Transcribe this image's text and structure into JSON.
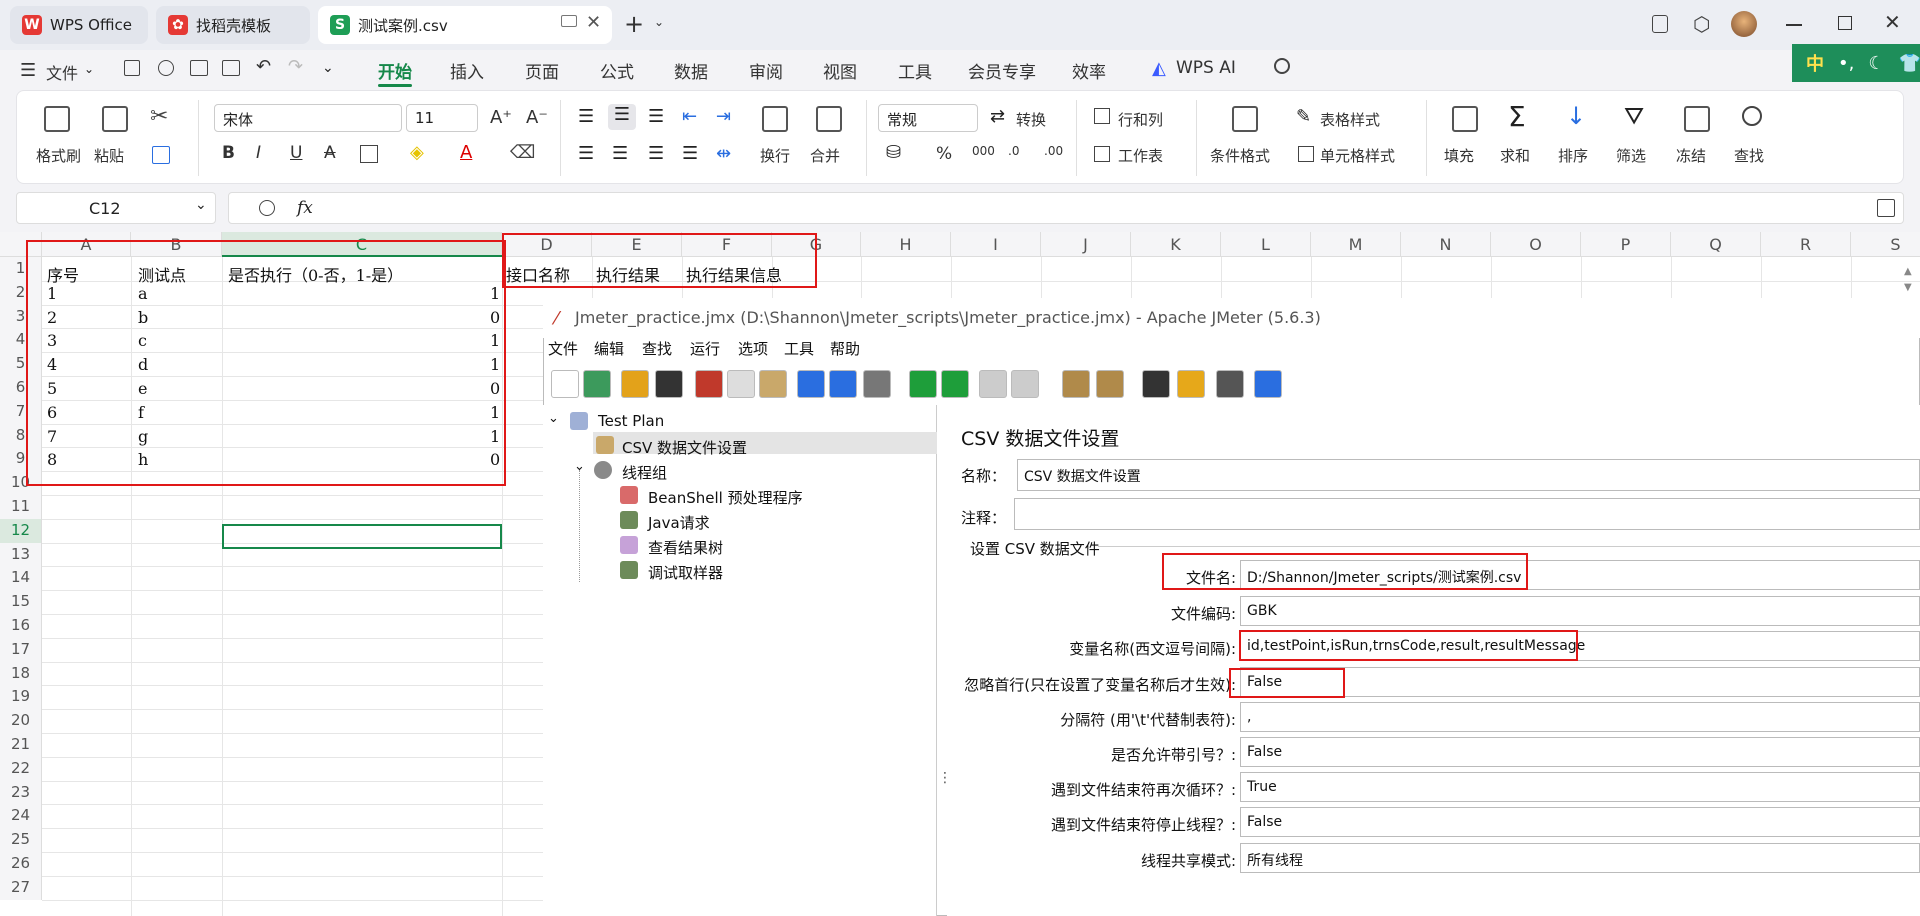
{
  "tabs": [
    {
      "label": "WPS Office"
    },
    {
      "label": "找稻壳模板"
    },
    {
      "label": "测试案例.csv"
    }
  ],
  "menu": {
    "file": "文件",
    "items": [
      "开始",
      "插入",
      "页面",
      "公式",
      "数据",
      "审阅",
      "视图",
      "工具",
      "会员专享",
      "效率"
    ],
    "wps_ai": "WPS AI",
    "ime": "中"
  },
  "ribbon": {
    "format_painter": "格式刷",
    "paste": "粘贴",
    "font": "宋体",
    "font_size": "11",
    "bold": "B",
    "italic": "I",
    "underline": "U",
    "wrap": "换行",
    "merge": "合并",
    "number_format": "常规",
    "convert": "转换",
    "rowcol": "行和列",
    "worksheet": "工作表",
    "cond_format": "条件格式",
    "table_style": "表格样式",
    "cell_style": "单元格样式",
    "fill": "填充",
    "sum": "求和",
    "sort": "排序",
    "filter": "筛选",
    "freeze": "冻结",
    "find": "查找"
  },
  "formula": {
    "cell_ref": "C12",
    "fx": "fx"
  },
  "sheet": {
    "columns": [
      "A",
      "B",
      "C",
      "D",
      "E",
      "F",
      "G",
      "H",
      "I",
      "J",
      "K",
      "L",
      "M",
      "N",
      "O",
      "P",
      "Q",
      "R",
      "S"
    ],
    "rows": [
      "1",
      "2",
      "3",
      "4",
      "5",
      "6",
      "7",
      "8",
      "9",
      "10",
      "11",
      "12",
      "13",
      "14",
      "15",
      "16",
      "17",
      "18",
      "19",
      "20",
      "21",
      "22",
      "23",
      "24",
      "25",
      "26",
      "27"
    ],
    "header": {
      "a": "序号",
      "b": "测试点",
      "c": "是否执行（0-否，1-是）",
      "d": "接口名称",
      "e": "执行结果",
      "f": "执行结果信息"
    },
    "data": [
      {
        "a": "1",
        "b": "a",
        "c": "1"
      },
      {
        "a": "2",
        "b": "b",
        "c": "0"
      },
      {
        "a": "3",
        "b": "c",
        "c": "1"
      },
      {
        "a": "4",
        "b": "d",
        "c": "1"
      },
      {
        "a": "5",
        "b": "e",
        "c": "0"
      },
      {
        "a": "6",
        "b": "f",
        "c": "1"
      },
      {
        "a": "7",
        "b": "g",
        "c": "1"
      },
      {
        "a": "8",
        "b": "h",
        "c": "0"
      }
    ]
  },
  "jmeter": {
    "title": "Jmeter_practice.jmx (D:\\Shannon\\Jmeter_scripts\\Jmeter_practice.jmx) - Apache JMeter (5.6.3)",
    "menu": [
      "文件",
      "编辑",
      "查找",
      "运行",
      "选项",
      "工具",
      "帮助"
    ],
    "tree": {
      "plan": "Test Plan",
      "csv": "CSV 数据文件设置",
      "thread_group": "线程组",
      "beanshell": "BeanShell 预处理程序",
      "java": "Java请求",
      "results": "查看结果树",
      "debug": "调试取样器"
    },
    "form": {
      "heading": "CSV 数据文件设置",
      "name_label": "名称：",
      "name_value": "CSV 数据文件设置",
      "comment_label": "注释：",
      "section": "设置 CSV 数据文件",
      "fields": [
        {
          "label": "文件名:",
          "value": "D:/Shannon/Jmeter_scripts/测试案例.csv"
        },
        {
          "label": "文件编码:",
          "value": "GBK"
        },
        {
          "label": "变量名称(西文逗号间隔):",
          "value": "id,testPoint,isRun,trnsCode,result,resultMessage"
        },
        {
          "label": "忽略首行(只在设置了变量名称后才生效):",
          "value": "False"
        },
        {
          "label": "分隔符 (用'\\t'代替制表符):",
          "value": ","
        },
        {
          "label": "是否允许带引号？:",
          "value": "False"
        },
        {
          "label": "遇到文件结束符再次循环？:",
          "value": "True"
        },
        {
          "label": "遇到文件结束符停止线程？:",
          "value": "False"
        },
        {
          "label": "线程共享模式:",
          "value": "所有线程"
        }
      ]
    }
  }
}
